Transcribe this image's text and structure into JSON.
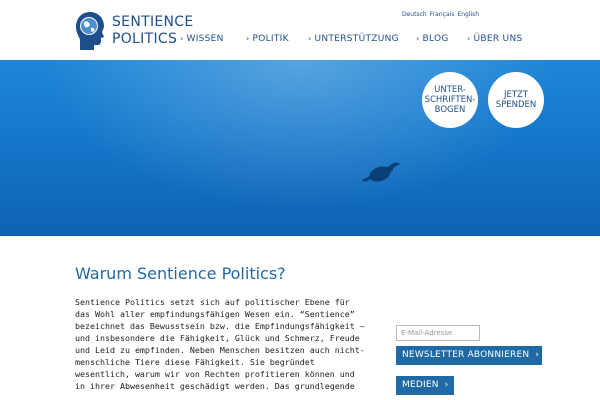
{
  "brand": {
    "line1": "SENTIENCE",
    "line2": "POLITICS"
  },
  "languages": [
    "Deutsch",
    "Français",
    "English"
  ],
  "nav": [
    {
      "label": "WISSEN"
    },
    {
      "label": "POLITIK"
    },
    {
      "label": "UNTERSTÜTZUNG"
    },
    {
      "label": "BLOG"
    },
    {
      "label": "ÜBER UNS"
    }
  ],
  "hero": {
    "button_1": {
      "line1": "UNTER-",
      "line2": "SCHRIFTEN-",
      "line3": "BOGEN"
    },
    "button_2": {
      "line1": "JETZT",
      "line2": "SPENDEN"
    }
  },
  "content": {
    "title": "Warum Sentience Politics?",
    "lines": [
      "Sentience Politics setzt sich auf politischer Ebene für",
      "das Wohl aller empfindungsfähigen Wesen ein. “Sentience”",
      "bezeichnet das Bewusstsein bzw. die Empfindungsfähigkeit –",
      "und insbesondere die Fähigkeit, Glück und Schmerz, Freude",
      "und Leid zu empfinden. Neben Menschen besitzen auch nicht-",
      "menschliche Tiere diese Fähigkeit. Sie begründet",
      "wesentlich, warum wir von Rechten profitieren können und",
      "in ihrer Abwesenheit geschädigt werden. Das grundlegende"
    ]
  },
  "sidebar": {
    "email_placeholder": "E-Mail-Adresse",
    "newsletter_label": "NEWSLETTER ABONNIEREN",
    "media_label": "MEDIEN"
  },
  "colors": {
    "brand": "#1f4f8a",
    "accent": "#1f6aa5",
    "hero": "#1679cc"
  },
  "icons": {
    "nav_chevron": "chevron-right-icon",
    "logo": "head-globe-icon"
  }
}
